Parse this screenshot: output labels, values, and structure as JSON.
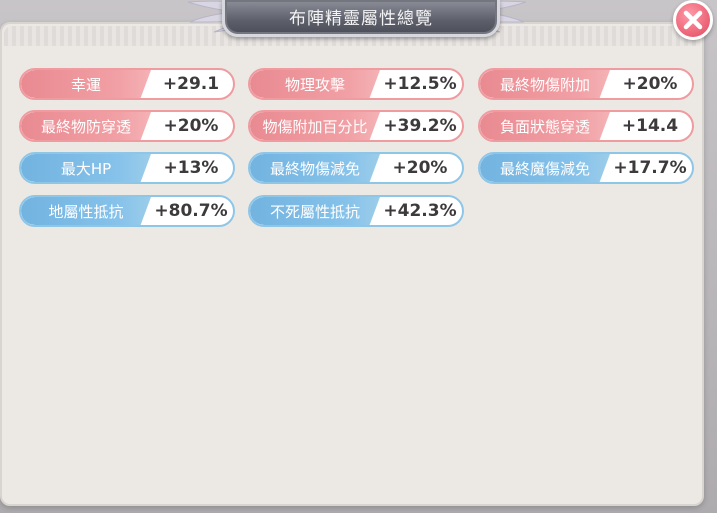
{
  "title": "布陣精靈屬性總覽",
  "colors": {
    "red_label": "#f1a0a5",
    "red_border": "#ef9b9f",
    "blue_label": "#86c2ea",
    "blue_border": "#8ec6e8",
    "close_button": "#ec6477"
  },
  "stats": [
    {
      "label": "幸運",
      "value": "+29.1",
      "color": "red"
    },
    {
      "label": "物理攻擊",
      "value": "+12.5%",
      "color": "red"
    },
    {
      "label": "最終物傷附加",
      "value": "+20%",
      "color": "red"
    },
    {
      "label": "最終物防穿透",
      "value": "+20%",
      "color": "red"
    },
    {
      "label": "物傷附加百分比",
      "value": "+39.2%",
      "color": "red"
    },
    {
      "label": "負面狀態穿透",
      "value": "+14.4",
      "color": "red"
    },
    {
      "label": "最大HP",
      "value": "+13%",
      "color": "blue"
    },
    {
      "label": "最終物傷減免",
      "value": "+20%",
      "color": "blue"
    },
    {
      "label": "最終魔傷減免",
      "value": "+17.7%",
      "color": "blue"
    },
    {
      "label": "地屬性抵抗",
      "value": "+80.7%",
      "color": "blue"
    },
    {
      "label": "不死屬性抵抗",
      "value": "+42.3%",
      "color": "blue"
    }
  ]
}
